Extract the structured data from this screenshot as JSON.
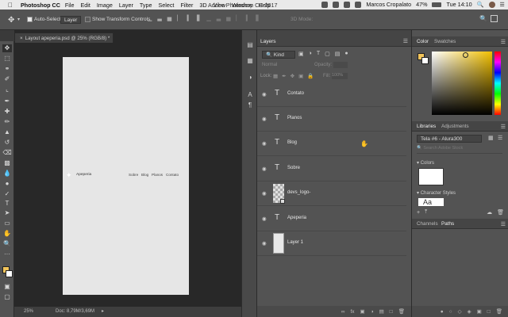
{
  "menubar": {
    "app_name": "Photoshop CC",
    "items": [
      "File",
      "Edit",
      "Image",
      "Layer",
      "Type",
      "Select",
      "Filter",
      "3D",
      "View",
      "Window",
      "Help"
    ],
    "window_title": "Adobe Photoshop CC 2017",
    "user": "Marcos Cropalato",
    "battery": "47%",
    "clock": "Tue 14:10"
  },
  "options": {
    "auto_select_label": "Auto-Select:",
    "auto_select_value": "Layer",
    "transform_label": "Show Transform Controls",
    "mode_3d": "3D Mode:"
  },
  "document": {
    "tab_title": "Layout apeperia.psd @ 25% (RGB/8) *",
    "zoom": "25%",
    "doc_info": "Doc: 8,79M/3,69M"
  },
  "canvas_site": {
    "logo": "Apeperia",
    "nav": [
      "Sobre",
      "Blog",
      "Planos",
      "Contato"
    ]
  },
  "layers": {
    "tab": "Layers",
    "filter_kind": "Kind",
    "blend_mode": "Normal",
    "opacity_label": "Opacity:",
    "lock_label": "Lock:",
    "fill_label": "Fill:",
    "fill_value": "100%",
    "items": [
      {
        "name": "Contato",
        "type": "text"
      },
      {
        "name": "Planos",
        "type": "text"
      },
      {
        "name": "Blog",
        "type": "text"
      },
      {
        "name": "Sobre",
        "type": "text"
      },
      {
        "name": "devs_logo-",
        "type": "smart"
      },
      {
        "name": "Apeperia",
        "type": "text"
      },
      {
        "name": "Layer 1",
        "type": "pixel"
      }
    ]
  },
  "color_panel": {
    "tabs": [
      "Color",
      "Swatches"
    ],
    "fg_color": "#f2c45a",
    "bg_color": "#ffffff"
  },
  "libraries": {
    "tabs": [
      "Libraries",
      "Adjustments"
    ],
    "library_select": "Tela #6 - Alura300",
    "search_placeholder": "Search Adobe Stock",
    "colors_label": "Colors",
    "char_styles_label": "Character Styles",
    "sample_text": "Aa"
  },
  "bottom_tabs": [
    "Channels",
    "Paths"
  ]
}
